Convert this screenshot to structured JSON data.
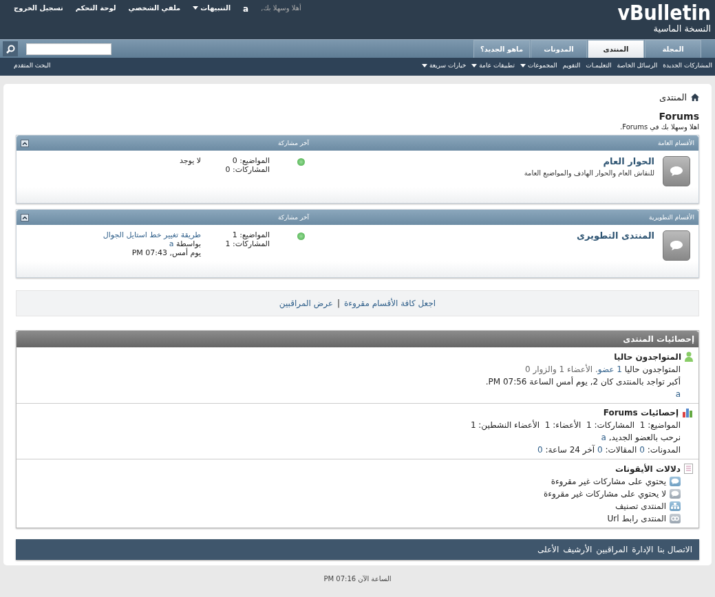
{
  "header": {
    "logo_text": "vBulletin",
    "logo_subtitle": "النسخة الماسية",
    "greeting": "أهلا وسهلا بك,",
    "username": "a",
    "links": [
      {
        "label": "التنبيهات",
        "dropdown": true
      },
      {
        "label": "ملفي الشخصي",
        "dropdown": false
      },
      {
        "label": "لوحة التحكم",
        "dropdown": false
      },
      {
        "label": "تسجيل الخروج",
        "dropdown": false
      }
    ]
  },
  "tabs": [
    {
      "label": "المجلة",
      "selected": false
    },
    {
      "label": "المنتدى",
      "selected": true
    },
    {
      "label": "المدونات",
      "selected": false
    },
    {
      "label": "ماهو الجديد؟",
      "selected": false
    }
  ],
  "subnav": {
    "items": [
      {
        "label": "المشاركات الجديدة",
        "dropdown": false
      },
      {
        "label": "الرسائل الخاصة",
        "dropdown": false
      },
      {
        "label": "التعليمـات",
        "dropdown": false
      },
      {
        "label": "التقويم",
        "dropdown": false
      },
      {
        "label": "المجموعات",
        "dropdown": true
      },
      {
        "label": "تطبيقات عامة",
        "dropdown": true
      },
      {
        "label": "خيارات سريعة",
        "dropdown": true
      }
    ],
    "advanced_search": "البحث المتقدم"
  },
  "breadcrumb": "المنتدى",
  "page_title": "Forums",
  "welcome": "اهلا وسهلا بك في Forums.",
  "categories": [
    {
      "title": "الأقسام العامة",
      "last_post_header": "آخر مشاركة",
      "forums": [
        {
          "name": "الحوار العام",
          "description": "للنقاش العام والحوار الهادف والمواضيع العامة",
          "topics": "المواضيع: 0",
          "posts": "المشاركات: 0",
          "last_post": {
            "kind": "none",
            "text": "لا يوجد"
          }
        }
      ]
    },
    {
      "title": "الأقسام التطويرية",
      "last_post_header": "آخر مشاركة",
      "forums": [
        {
          "name": "المنتدى التطويرى",
          "topics": "المواضيع: 1",
          "posts": "المشاركات: 1",
          "last_post": {
            "kind": "post",
            "title": "طريقة تغيير خط استايل الجوال",
            "by": "بواسطة",
            "user": "a",
            "time": "يوم أمس, 07:43 PM"
          }
        }
      ]
    }
  ],
  "actions": {
    "mark_read": "اجعل كافة الأقسام مقروءة",
    "separator": "|",
    "moderators": "عرض المراقبين"
  },
  "stats": {
    "title": "إحصائيات المنتدى",
    "online": {
      "title": "المتواجدون حاليا",
      "line": [
        {
          "kind": "plain",
          "text": "المتواجدون حاليا "
        },
        {
          "kind": "link",
          "text": "1 عضو"
        },
        {
          "kind": "muted",
          "text": ". الأعضاء 1 والزوار 0"
        }
      ],
      "record": "أكبر تواجد بالمنتدى كان 2, يوم أمس الساعة 07:56 PM.",
      "user": "a"
    },
    "forum_stats": {
      "title": "إحصائيات Forums",
      "line": "المواضيع: 1  المشاركات: 1  الأعضاء: 1  الأعضاء النشطين: 1",
      "welcome": "نرحب بالعضو الجديد,",
      "user": "a",
      "blogs": [
        {
          "label": "المدونات:",
          "value": "0"
        },
        {
          "label": "المقالات:",
          "value": "0"
        },
        {
          "label": "آخر 24 ساعة:",
          "value": "0"
        }
      ]
    },
    "legend": {
      "title": "دلالات الأيقونات",
      "items": [
        {
          "kind": "new",
          "text": "يحتوي على مشاركات غير مقروءة"
        },
        {
          "kind": "old",
          "text": "لا يحتوي على مشاركات غير مقروءة"
        },
        {
          "kind": "category",
          "text": "المنتدى تصنيف"
        },
        {
          "kind": "link",
          "text": "المنتدى رابط Url"
        }
      ]
    }
  },
  "footer": {
    "links": [
      "الاتصال بنا",
      "الإدارة",
      "المراقبين",
      "الأرشيف",
      "الأعلى"
    ],
    "time": "الساعة الآن 07:16 PM"
  }
}
